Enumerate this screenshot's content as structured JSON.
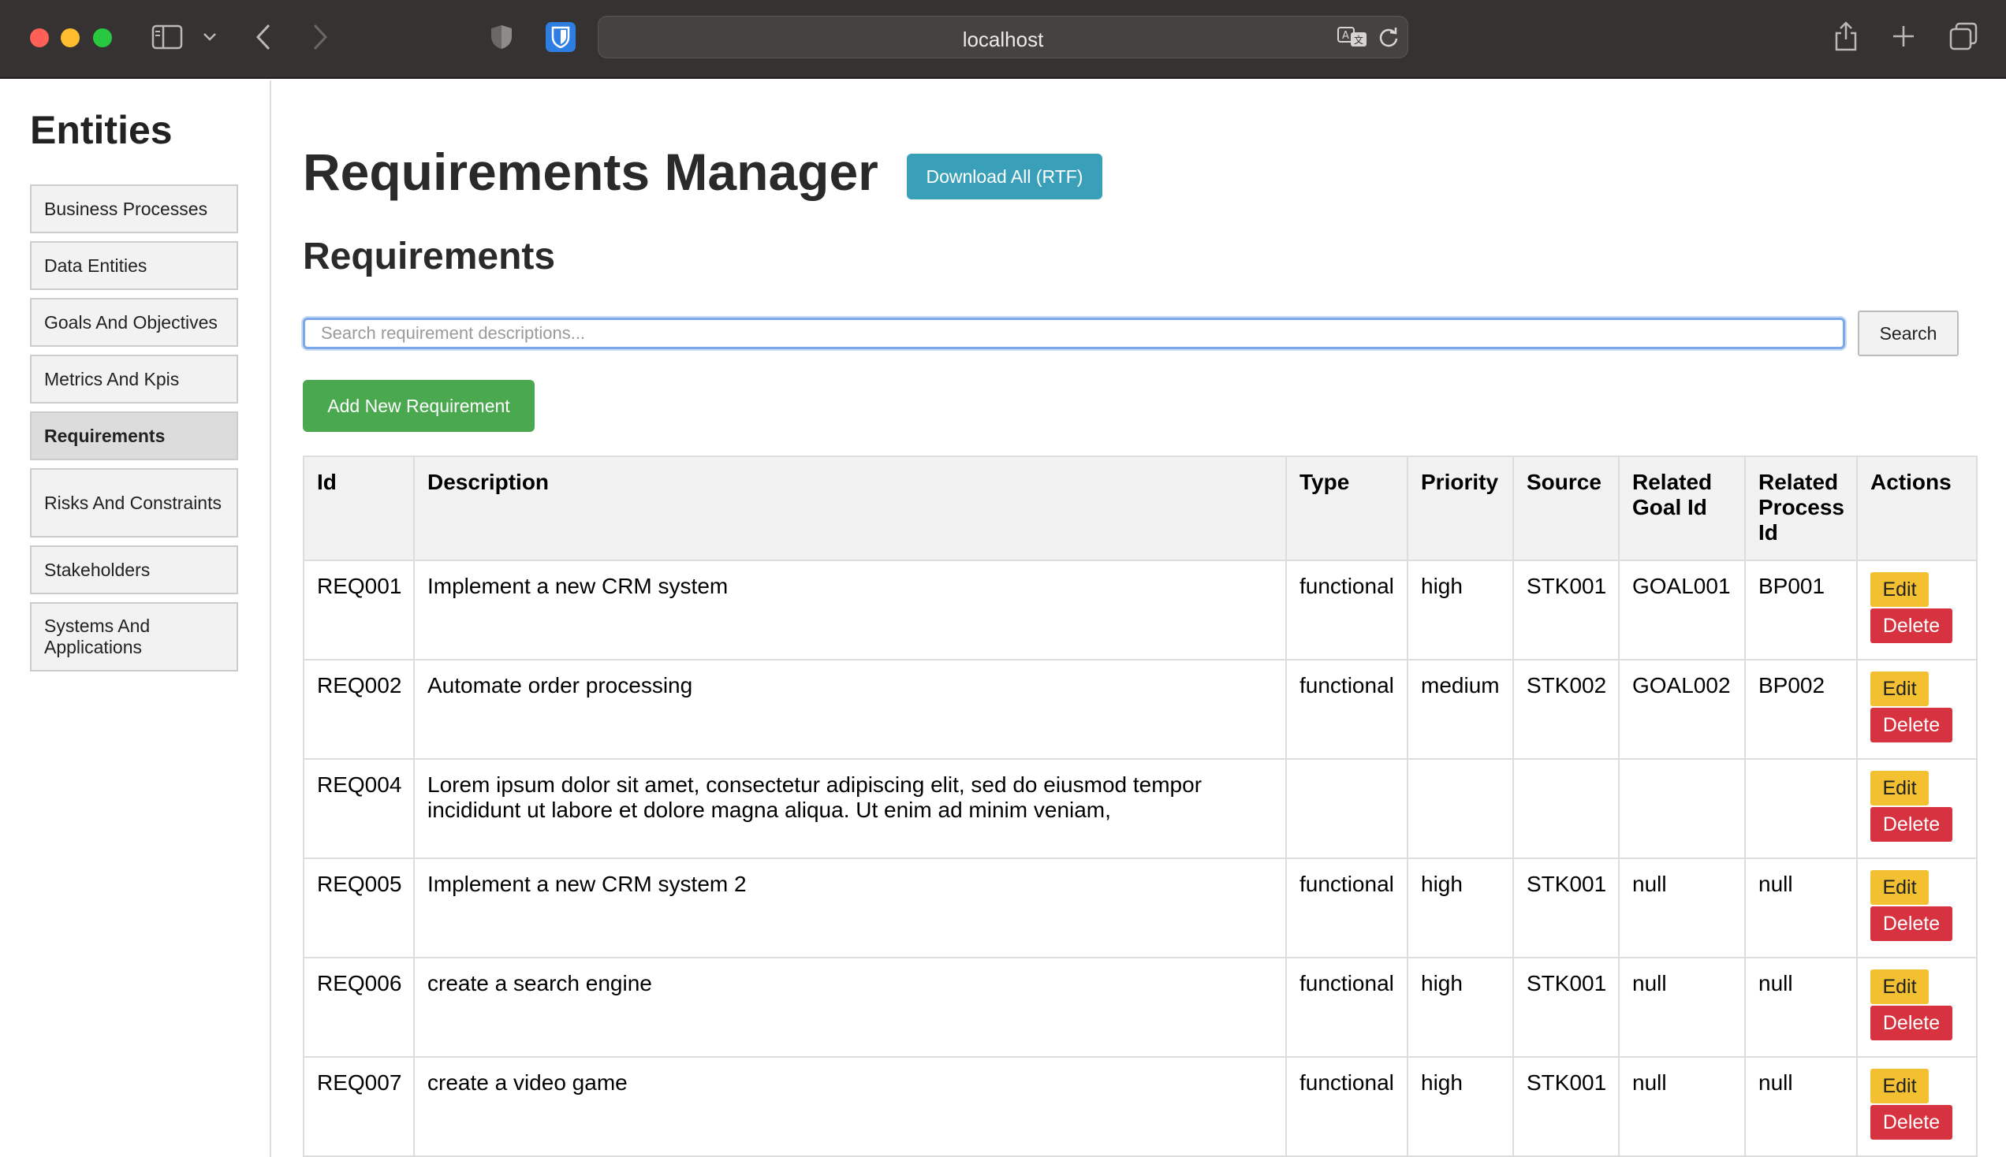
{
  "browser": {
    "url": "localhost"
  },
  "sidebar": {
    "title": "Entities",
    "items": [
      {
        "label": "Business Processes",
        "active": false
      },
      {
        "label": "Data Entities",
        "active": false
      },
      {
        "label": "Goals And Objectives",
        "active": false
      },
      {
        "label": "Metrics And Kpis",
        "active": false
      },
      {
        "label": "Requirements",
        "active": true
      },
      {
        "label": "Risks And Constraints",
        "active": false
      },
      {
        "label": "Stakeholders",
        "active": false
      },
      {
        "label": "Systems And Applications",
        "active": false
      }
    ]
  },
  "main": {
    "title": "Requirements Manager",
    "download_label": "Download All (RTF)",
    "section_title": "Requirements",
    "search_placeholder": "Search requirement descriptions...",
    "search_value": "",
    "search_label": "Search",
    "add_label": "Add New Requirement"
  },
  "table": {
    "headers": [
      "Id",
      "Description",
      "Type",
      "Priority",
      "Source",
      "Related Goal Id",
      "Related Process Id",
      "Actions"
    ],
    "edit_label": "Edit",
    "delete_label": "Delete",
    "rows": [
      {
        "id": "REQ001",
        "description": "Implement a new CRM system",
        "type": "functional",
        "priority": "high",
        "source": "STK001",
        "goal": "GOAL001",
        "process": "BP001"
      },
      {
        "id": "REQ002",
        "description": "Automate order processing",
        "type": "functional",
        "priority": "medium",
        "source": "STK002",
        "goal": "GOAL002",
        "process": "BP002"
      },
      {
        "id": "REQ004",
        "description": "Lorem ipsum dolor sit amet, consectetur adipiscing elit, sed do eiusmod tempor incididunt ut labore et dolore magna aliqua. Ut enim ad minim veniam,",
        "type": "",
        "priority": "",
        "source": "",
        "goal": "",
        "process": ""
      },
      {
        "id": "REQ005",
        "description": "Implement a new CRM system 2",
        "type": "functional",
        "priority": "high",
        "source": "STK001",
        "goal": "null",
        "process": "null"
      },
      {
        "id": "REQ006",
        "description": "create a search engine",
        "type": "functional",
        "priority": "high",
        "source": "STK001",
        "goal": "null",
        "process": "null"
      },
      {
        "id": "REQ007",
        "description": "create a video game",
        "type": "functional",
        "priority": "high",
        "source": "STK001",
        "goal": "null",
        "process": "null"
      }
    ]
  }
}
